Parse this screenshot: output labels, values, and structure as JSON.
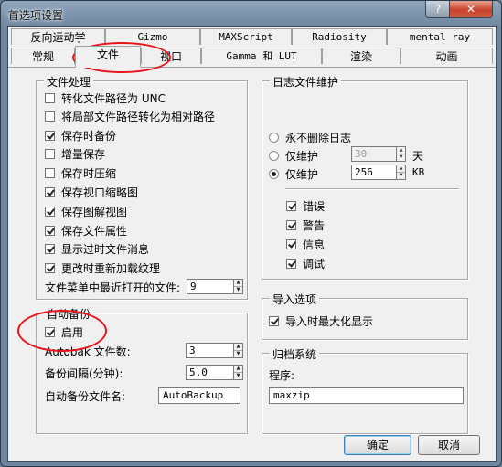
{
  "window": {
    "title": "首选项设置",
    "help_label": "?",
    "close_label": "✕"
  },
  "tabs_row1": [
    "反向运动学",
    "Gizmo",
    "MAXScript",
    "Radiosity",
    "mental ray"
  ],
  "tabs_row2": [
    "常规",
    "文件",
    "视口",
    "Gamma 和 LUT",
    "渲染",
    "动画"
  ],
  "active_tab": "文件",
  "file_handling": {
    "legend": "文件处理",
    "options": [
      {
        "label": "转化文件路径为 UNC",
        "checked": false
      },
      {
        "label": "将局部文件路径转化为相对路径",
        "checked": false
      },
      {
        "label": "保存时备份",
        "checked": true
      },
      {
        "label": "增量保存",
        "checked": false
      },
      {
        "label": "保存时压缩",
        "checked": false
      },
      {
        "label": "保存视口缩略图",
        "checked": true
      },
      {
        "label": "保存图解视图",
        "checked": true
      },
      {
        "label": "保存文件属性",
        "checked": true
      },
      {
        "label": "显示过时文件消息",
        "checked": true
      },
      {
        "label": "更改时重新加载纹理",
        "checked": true
      }
    ],
    "recent_label": "文件菜单中最近打开的文件:",
    "recent_value": "9"
  },
  "autobackup": {
    "legend": "自动备份",
    "enable_label": "启用",
    "enable_checked": true,
    "count_label": "Autobak 文件数:",
    "count_value": "3",
    "interval_label": "备份间隔(分钟):",
    "interval_value": "5.0",
    "name_label": "自动备份文件名:",
    "name_value": "AutoBackup"
  },
  "log": {
    "legend": "日志文件维护",
    "never_delete": "永不删除日志",
    "keep_days_label": "仅维护",
    "keep_days_value": "30",
    "days_unit": "天",
    "keep_kb_label": "仅维护",
    "keep_kb_value": "256",
    "kb_unit": "KB",
    "selected": "kb",
    "levels": [
      {
        "label": "错误",
        "checked": true
      },
      {
        "label": "警告",
        "checked": true
      },
      {
        "label": "信息",
        "checked": true
      },
      {
        "label": "调试",
        "checked": true
      }
    ]
  },
  "import": {
    "legend": "导入选项",
    "maximize_label": "导入时最大化显示",
    "maximize_checked": true
  },
  "archive": {
    "legend": "归档系统",
    "program_label": "程序:",
    "program_value": "maxzip"
  },
  "buttons": {
    "ok": "确定",
    "cancel": "取消"
  },
  "colors": {
    "highlight_circle": "#e8141a",
    "title_bar": "#7f95ad"
  }
}
